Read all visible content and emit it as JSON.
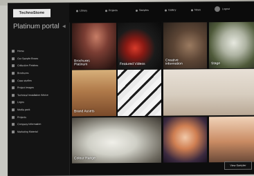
{
  "brand": {
    "logo_text": "TechnoStone"
  },
  "sidebar": {
    "title": "Platinum portal",
    "items": [
      {
        "label": "Home"
      },
      {
        "label": "Our Sample Boxes"
      },
      {
        "label": "Collection Finishes"
      },
      {
        "label": "Brochures"
      },
      {
        "label": "Case studies"
      },
      {
        "label": "Project Images"
      },
      {
        "label": "Technical Installation Advice"
      },
      {
        "label": "Logos"
      },
      {
        "label": "Media pack"
      },
      {
        "label": "Projects"
      },
      {
        "label": "Company Information"
      },
      {
        "label": "Marketing Material"
      }
    ]
  },
  "topnav": {
    "items": [
      {
        "label": "Library"
      },
      {
        "label": "Projects"
      },
      {
        "label": "Samples"
      },
      {
        "label": "Gallery"
      },
      {
        "label": "News"
      }
    ],
    "user_label": "Logout"
  },
  "tiles": [
    {
      "caption": "Brochures\nPlatinum"
    },
    {
      "caption": "Featured Videos"
    },
    {
      "caption": "Creative\ninformation"
    },
    {
      "caption": "Stage"
    },
    {
      "caption": "Brand Assets"
    },
    {
      "caption": ""
    },
    {
      "caption": ""
    },
    {
      "caption": "Colour Range"
    },
    {
      "caption": ""
    },
    {
      "caption": ""
    }
  ],
  "footer": {
    "view_button": "View Sampler"
  },
  "colors": {
    "background": "#0d0d0d",
    "sidebar": "#141414",
    "text": "#cfcfcf"
  }
}
